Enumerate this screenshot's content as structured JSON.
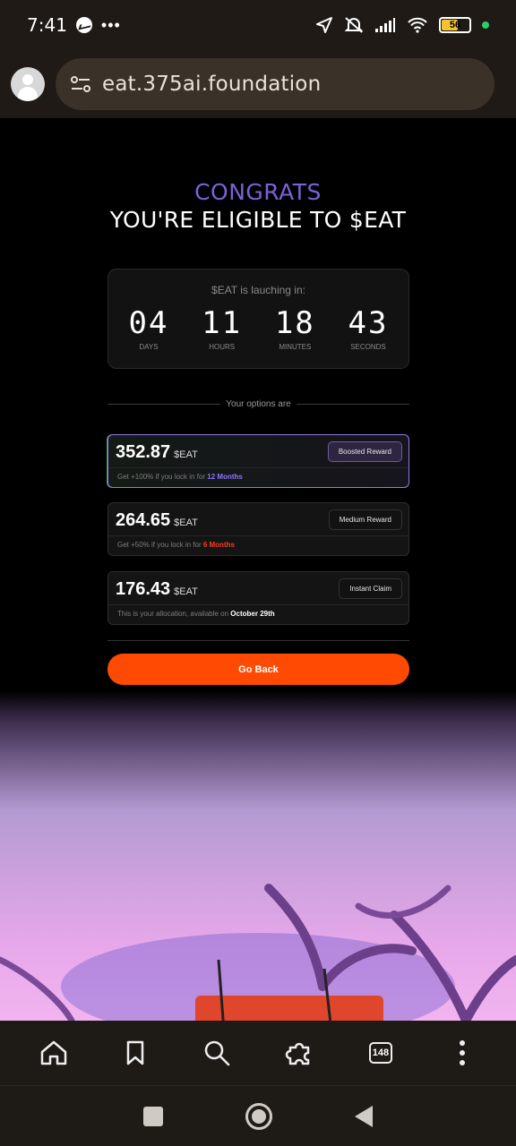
{
  "status_bar": {
    "time": "7:41",
    "more": "•••",
    "battery": "56"
  },
  "browser": {
    "url": "eat.375ai.foundation",
    "tab_count": "148"
  },
  "hero": {
    "line1": "CONGRATS",
    "line2": "YOU'RE ELIGIBLE TO $EAT"
  },
  "countdown": {
    "title": "$EAT is lauching in:",
    "units": [
      {
        "value": "04",
        "label": "DAYS"
      },
      {
        "value": "11",
        "label": "HOURS"
      },
      {
        "value": "18",
        "label": "MINUTES"
      },
      {
        "value": "43",
        "label": "SECONDS"
      }
    ]
  },
  "options_label": "Your options are",
  "options": [
    {
      "amount": "352.87",
      "unit": "$EAT",
      "button": "Boosted Reward",
      "note_prefix": "Get +100% if you lock in for ",
      "note_highlight": "12 Months",
      "highlight_color": "#8e74ff"
    },
    {
      "amount": "264.65",
      "unit": "$EAT",
      "button": "Medium Reward",
      "note_prefix": "Get +50% if you lock in for ",
      "note_highlight": "6 Months",
      "highlight_color": "#ff3b1f"
    },
    {
      "amount": "176.43",
      "unit": "$EAT",
      "button": "Instant Claim",
      "note_prefix": "This is your allocation, available on ",
      "note_highlight": "October 29th",
      "highlight_color": "#ffffff"
    }
  ],
  "go_back": "Go Back",
  "colors": {
    "accent_purple": "#7b62d6",
    "cta_orange": "#ff4a04"
  },
  "nav_icons": [
    "home-icon",
    "bookmark-icon",
    "search-icon",
    "extensions-icon",
    "tabs-icon",
    "more-icon"
  ]
}
